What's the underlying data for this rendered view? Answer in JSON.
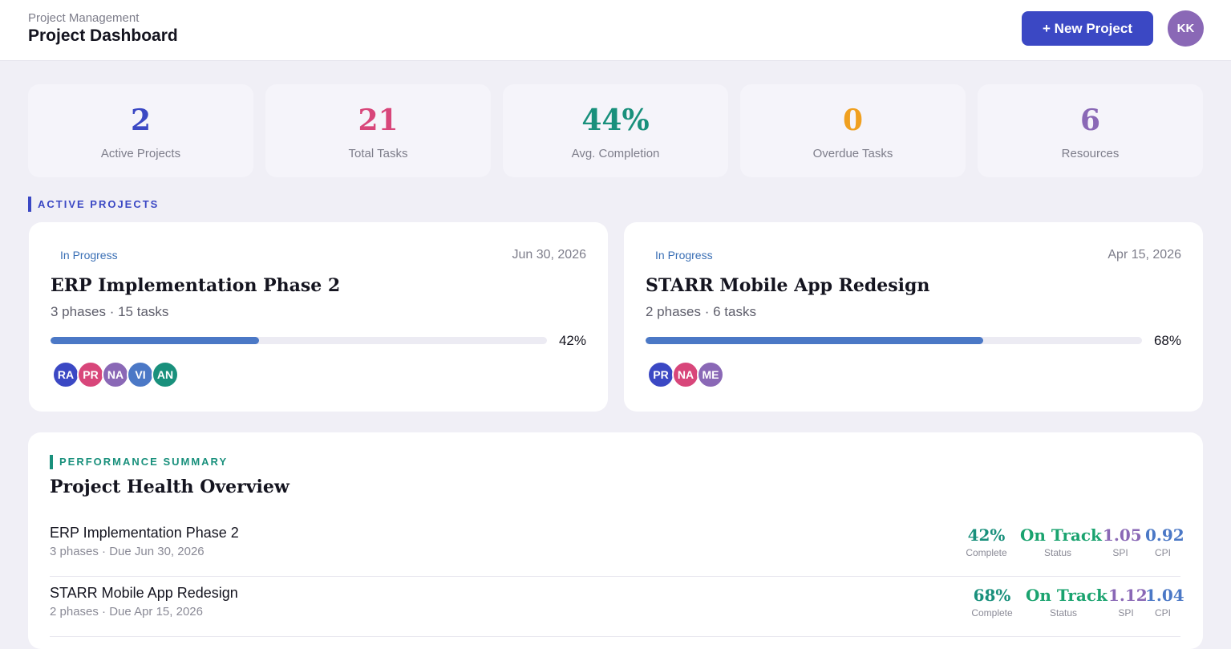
{
  "header": {
    "breadcrumb": "Project Management",
    "title": "Project Dashboard",
    "new_project_label": "+ New Project",
    "user_initials": "KK"
  },
  "stats": [
    {
      "value": "2",
      "label": "Active Projects",
      "color": "#3b48c4"
    },
    {
      "value": "21",
      "label": "Total Tasks",
      "color": "#d8467a"
    },
    {
      "value": "44%",
      "label": "Avg. Completion",
      "color": "#19907c"
    },
    {
      "value": "0",
      "label": "Overdue Tasks",
      "color": "#f0a020"
    },
    {
      "value": "6",
      "label": "Resources",
      "color": "#8a68b6"
    }
  ],
  "active_section": {
    "title": "ACTIVE PROJECTS"
  },
  "projects": [
    {
      "status": "In Progress",
      "due": "Jun 30, 2026",
      "name": "ERP Implementation Phase 2",
      "meta": "3 phases · 15 tasks",
      "progress": 0.42,
      "progress_label": "42%",
      "members": [
        {
          "initials": "RA",
          "color": "#3b48c4"
        },
        {
          "initials": "PR",
          "color": "#d8467a"
        },
        {
          "initials": "NA",
          "color": "#8a68b6"
        },
        {
          "initials": "VI",
          "color": "#4b78c6"
        },
        {
          "initials": "AN",
          "color": "#19907c"
        }
      ]
    },
    {
      "status": "In Progress",
      "due": "Apr 15, 2026",
      "name": "STARR Mobile App Redesign",
      "meta": "2 phases · 6 tasks",
      "progress": 0.68,
      "progress_label": "68%",
      "members": [
        {
          "initials": "PR",
          "color": "#3b48c4"
        },
        {
          "initials": "NA",
          "color": "#d8467a"
        },
        {
          "initials": "ME",
          "color": "#8a68b6"
        }
      ]
    }
  ],
  "performance": {
    "section_label": "PERFORMANCE SUMMARY",
    "title": "Project Health Overview",
    "rows": [
      {
        "name": "ERP Implementation Phase 2",
        "meta": "3 phases · Due Jun 30, 2026",
        "complete": "42%",
        "complete_label": "Complete",
        "status": "On Track",
        "status_label": "Status",
        "spi": "1.05",
        "spi_label": "SPI",
        "cpi": "0.92",
        "cpi_label": "CPI"
      },
      {
        "name": "STARR Mobile App Redesign",
        "meta": "2 phases · Due Apr 15, 2026",
        "complete": "68%",
        "complete_label": "Complete",
        "status": "On Track",
        "status_label": "Status",
        "spi": "1.12",
        "spi_label": "SPI",
        "cpi": "1.04",
        "cpi_label": "CPI"
      }
    ],
    "colors": {
      "complete": "#19907c",
      "status": "#1aa36f",
      "spi": "#8a68b6",
      "cpi": "#4b78c6"
    }
  }
}
